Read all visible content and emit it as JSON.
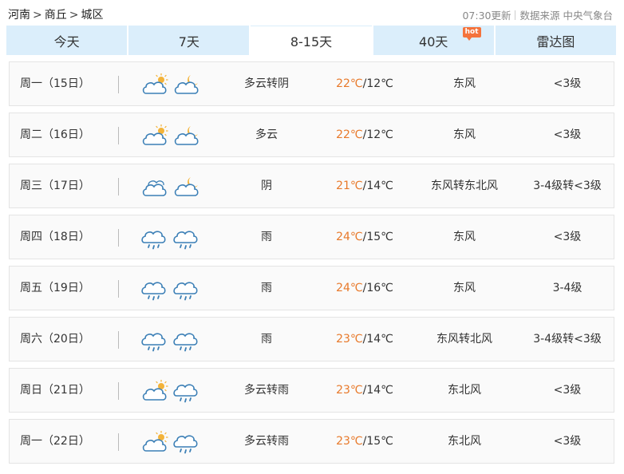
{
  "breadcrumb": {
    "province": "河南",
    "city": "商丘",
    "district": "城区",
    "separator": ">"
  },
  "source": {
    "update_time": "07:30更新",
    "label": "数据来源",
    "agency": "中央气象台"
  },
  "tabs": [
    {
      "label": "今天",
      "active": false
    },
    {
      "label": "7天",
      "active": false
    },
    {
      "label": "8-15天",
      "active": true
    },
    {
      "label": "40天",
      "active": false,
      "badge": "hot"
    },
    {
      "label": "雷达图",
      "active": false
    }
  ],
  "colors": {
    "tab_bg": "#dbeefb",
    "high_temp": "#e8792a",
    "icon_stroke": "#3b7fb6",
    "sun": "#f3b339"
  },
  "forecast": [
    {
      "date": "周一（15日）",
      "icons": [
        "partly-cloudy-day-icon",
        "partly-cloudy-night-icon"
      ],
      "condition": "多云转阴",
      "high": "22℃",
      "low": "/12℃",
      "wind": "东风",
      "level": "<3级"
    },
    {
      "date": "周二（16日）",
      "icons": [
        "partly-cloudy-day-icon",
        "partly-cloudy-night-icon"
      ],
      "condition": "多云",
      "high": "22℃",
      "low": "/12℃",
      "wind": "东风",
      "level": "<3级"
    },
    {
      "date": "周三（17日）",
      "icons": [
        "overcast-icon",
        "partly-cloudy-night-icon"
      ],
      "condition": "阴",
      "high": "21℃",
      "low": "/14℃",
      "wind": "东风转东北风",
      "level": "3-4级转<3级"
    },
    {
      "date": "周四（18日）",
      "icons": [
        "rain-icon",
        "rain-icon"
      ],
      "condition": "雨",
      "high": "24℃",
      "low": "/15℃",
      "wind": "东风",
      "level": "<3级"
    },
    {
      "date": "周五（19日）",
      "icons": [
        "rain-icon",
        "rain-icon"
      ],
      "condition": "雨",
      "high": "24℃",
      "low": "/16℃",
      "wind": "东风",
      "level": "3-4级"
    },
    {
      "date": "周六（20日）",
      "icons": [
        "rain-icon",
        "rain-icon"
      ],
      "condition": "雨",
      "high": "23℃",
      "low": "/14℃",
      "wind": "东风转北风",
      "level": "3-4级转<3级"
    },
    {
      "date": "周日（21日）",
      "icons": [
        "partly-cloudy-day-icon",
        "rain-icon"
      ],
      "condition": "多云转雨",
      "high": "23℃",
      "low": "/14℃",
      "wind": "东北风",
      "level": "<3级"
    },
    {
      "date": "周一（22日）",
      "icons": [
        "partly-cloudy-day-icon",
        "rain-icon"
      ],
      "condition": "多云转雨",
      "high": "23℃",
      "low": "/15℃",
      "wind": "东北风",
      "level": "<3级"
    }
  ]
}
